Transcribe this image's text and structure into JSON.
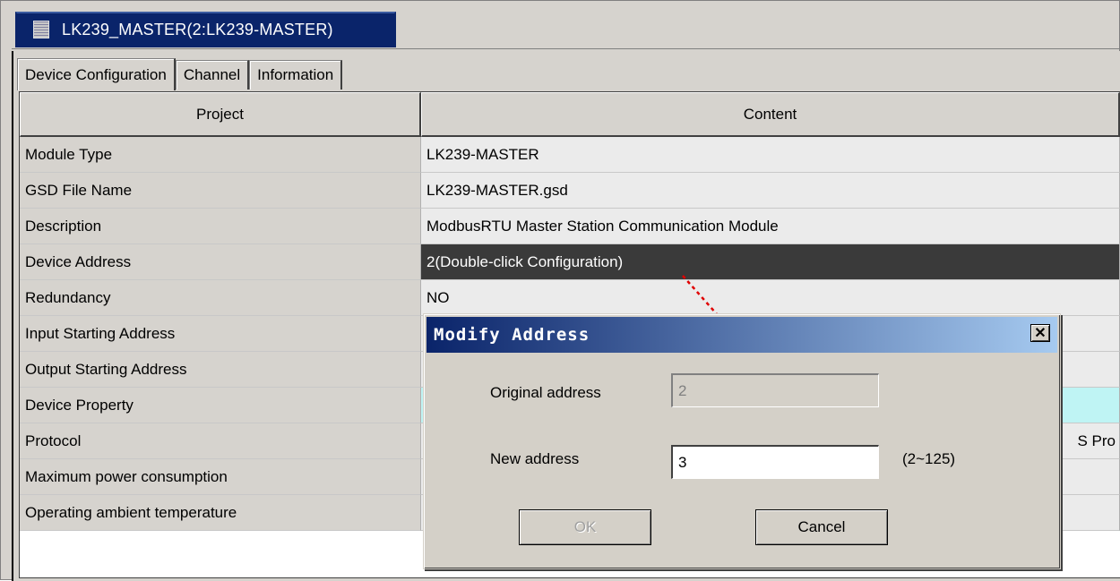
{
  "window": {
    "tab_title": "LK239_MASTER(2:LK239-MASTER)"
  },
  "tabs": [
    {
      "label": "Device Configuration",
      "active": true
    },
    {
      "label": "Channel",
      "active": false
    },
    {
      "label": "Information",
      "active": false
    }
  ],
  "grid": {
    "headers": {
      "project": "Project",
      "content": "Content"
    },
    "rows": [
      {
        "project": "Module Type",
        "content": "LK239-MASTER"
      },
      {
        "project": "GSD File Name",
        "content": "LK239-MASTER.gsd"
      },
      {
        "project": "Description",
        "content": "ModbusRTU Master Station Communication Module"
      },
      {
        "project": "Device Address",
        "content": "2(Double-click Configuration)"
      },
      {
        "project": "Redundancy",
        "content": "NO"
      },
      {
        "project": "Input Starting Address",
        "content": ""
      },
      {
        "project": "Output Starting Address",
        "content": ""
      },
      {
        "project": "Device Property",
        "content": ""
      },
      {
        "project": "Protocol",
        "content": "S Pro"
      },
      {
        "project": "Maximum power consumption",
        "content": ""
      },
      {
        "project": "Operating ambient temperature",
        "content": ""
      }
    ]
  },
  "dialog": {
    "title": "Modify Address",
    "close_glyph": "✕",
    "original_label": "Original address",
    "original_value": "2",
    "new_label": "New address",
    "new_value": "3",
    "range_hint": "(2~125)",
    "ok_label": "OK",
    "cancel_label": "Cancel"
  },
  "colors": {
    "selected_row": "#3a3a3a",
    "device_property_row": "#bff4f4",
    "title_bar_start": "#0a246a",
    "title_bar_end": "#a6caf0",
    "arrow": "#e00000"
  }
}
